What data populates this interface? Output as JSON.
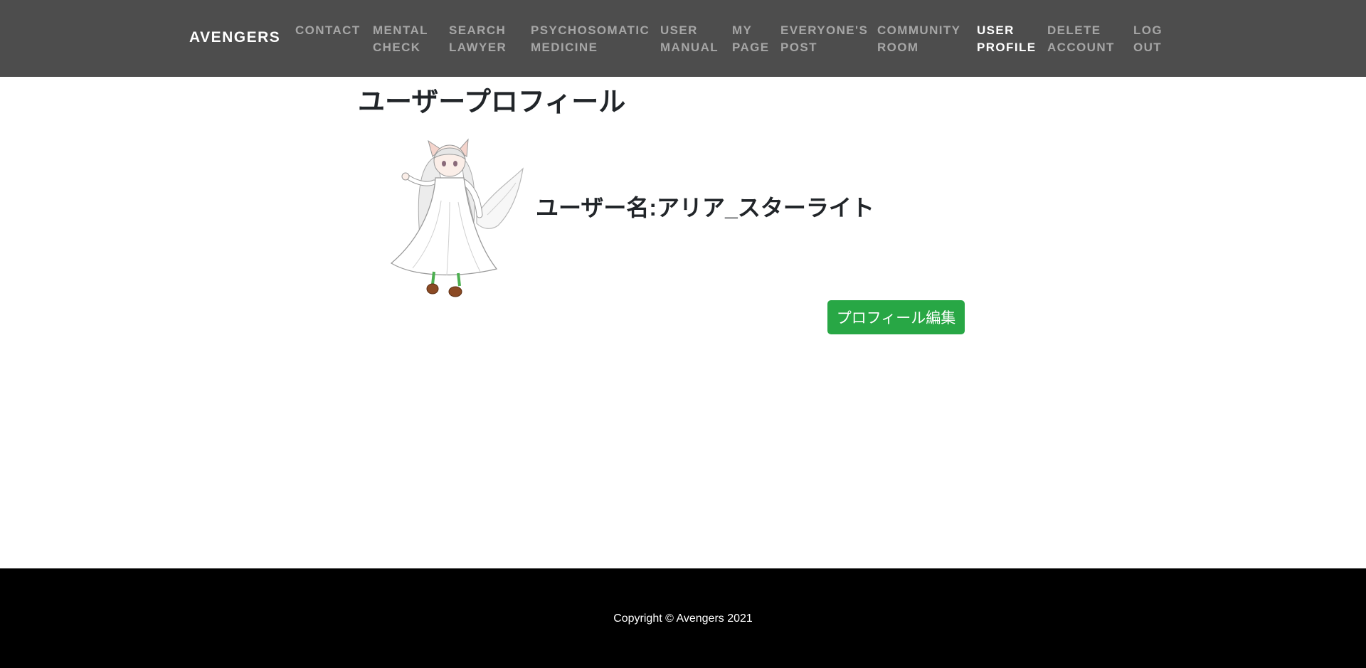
{
  "navbar": {
    "brand": "AVENGERS",
    "items": [
      {
        "id": "contact",
        "lines": [
          "CONTACT"
        ],
        "active": false
      },
      {
        "id": "mental-check",
        "lines": [
          "MENTAL",
          "CHECK"
        ],
        "active": false
      },
      {
        "id": "search-lawyer",
        "lines": [
          "SEARCH",
          "LAWYER"
        ],
        "active": false
      },
      {
        "id": "psychosomatic-medicine",
        "lines": [
          "PSYCHOSOMATIC",
          "MEDICINE"
        ],
        "active": false
      },
      {
        "id": "user-manual",
        "lines": [
          "USER",
          "MANUAL"
        ],
        "active": false
      },
      {
        "id": "my-page",
        "lines": [
          "MY",
          "PAGE"
        ],
        "active": false
      },
      {
        "id": "everyones-post",
        "lines": [
          "EVERYONE'S",
          "POST"
        ],
        "active": false
      },
      {
        "id": "community-room",
        "lines": [
          "COMMUNITY",
          "ROOM"
        ],
        "active": false
      },
      {
        "id": "user-profile",
        "lines": [
          "USER",
          "PROFILE"
        ],
        "active": true
      },
      {
        "id": "delete-account",
        "lines": [
          "DELETE",
          "ACCOUNT"
        ],
        "active": false
      },
      {
        "id": "log-out",
        "lines": [
          "LOG",
          "OUT"
        ],
        "active": false
      }
    ],
    "colors": {
      "background": "#4d4d4d",
      "link": "#a6a6a6",
      "active": "#ffffff"
    }
  },
  "main": {
    "title": "ユーザープロフィール",
    "username_label": "ユーザー名:",
    "username": "アリア_スターライト",
    "edit_button": "プロフィール編集",
    "avatar_icon": "avatar-illustration"
  },
  "footer": {
    "copyright": "Copyright © Avengers 2021"
  },
  "colors": {
    "button_green": "#28a745",
    "footer_bg": "#000000"
  }
}
